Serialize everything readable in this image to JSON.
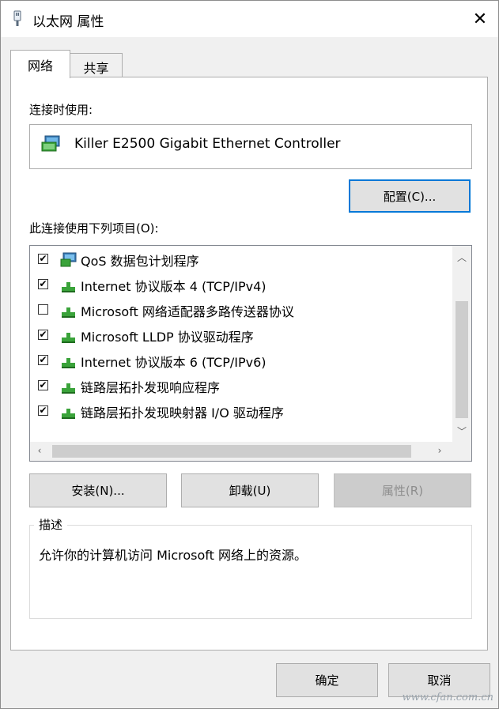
{
  "window": {
    "title": "以太网 属性",
    "close_glyph": "✕"
  },
  "tabs": [
    {
      "label": "网络",
      "active": true
    },
    {
      "label": "共享",
      "active": false
    }
  ],
  "connect_using": {
    "label": "连接时使用:",
    "adapter_name": "Killer E2500 Gigabit Ethernet Controller",
    "configure_button": "配置(C)..."
  },
  "items_section": {
    "label": "此连接使用下列项目(O):",
    "items": [
      {
        "label": "QoS 数据包计划程序",
        "checked": true,
        "icon": "network-service-icon"
      },
      {
        "label": "Internet 协议版本 4 (TCP/IPv4)",
        "checked": true,
        "icon": "protocol-icon"
      },
      {
        "label": "Microsoft 网络适配器多路传送器协议",
        "checked": false,
        "icon": "protocol-icon"
      },
      {
        "label": "Microsoft LLDP 协议驱动程序",
        "checked": true,
        "icon": "protocol-icon"
      },
      {
        "label": "Internet 协议版本 6 (TCP/IPv6)",
        "checked": true,
        "icon": "protocol-icon"
      },
      {
        "label": "链路层拓扑发现响应程序",
        "checked": true,
        "icon": "protocol-icon"
      },
      {
        "label": "链路层拓扑发现映射器 I/O 驱动程序",
        "checked": true,
        "icon": "protocol-icon"
      }
    ],
    "check_glyph": "✔"
  },
  "action_buttons": {
    "install": "安装(N)...",
    "uninstall": "卸载(U)",
    "properties": "属性(R)"
  },
  "description": {
    "title": "描述",
    "text": "允许你的计算机访问 Microsoft 网络上的资源。"
  },
  "dialog_buttons": {
    "ok": "确定",
    "cancel": "取消"
  },
  "watermark": "www.cfan.com.cn",
  "colors": {
    "focus_border": "#0078d7",
    "protocol_green": "#3aa33a"
  }
}
